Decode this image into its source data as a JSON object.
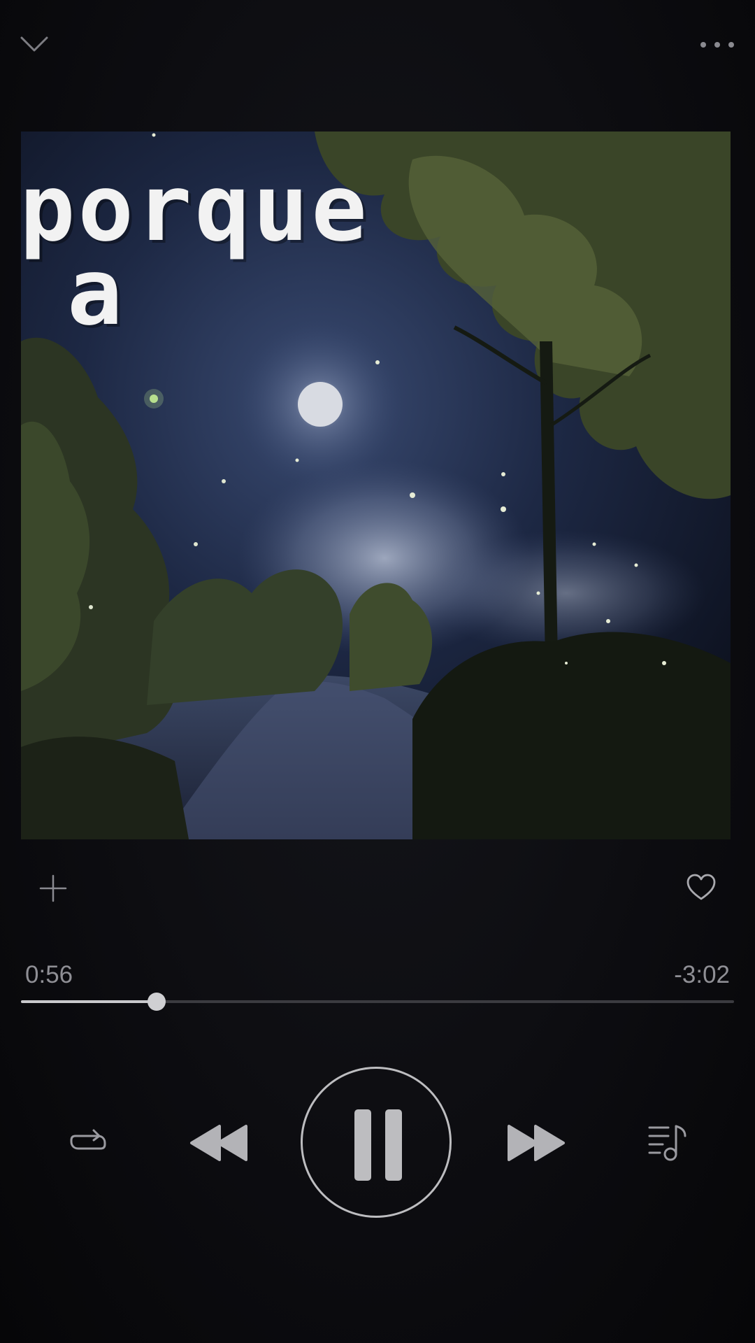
{
  "header": {
    "collapse_icon": "chevron-down-icon",
    "more_icon": "more-horizontal-icon"
  },
  "artwork": {
    "title_line1": "porque",
    "title_line2": "a"
  },
  "actions": {
    "add_icon": "plus-icon",
    "like_icon": "heart-outline-icon"
  },
  "playback": {
    "elapsed": "0:56",
    "remaining": "-3:02",
    "progress": 0.19
  },
  "controls": {
    "repeat_icon": "repeat-icon",
    "previous_icon": "rewind-icon",
    "play_pause_icon": "pause-icon",
    "next_icon": "fast-forward-icon",
    "queue_icon": "queue-music-icon"
  },
  "colors": {
    "background": "#0b0b0e",
    "accent": "#c9c9cc",
    "track": "#3b3b40",
    "text_muted": "#8f8f95"
  }
}
